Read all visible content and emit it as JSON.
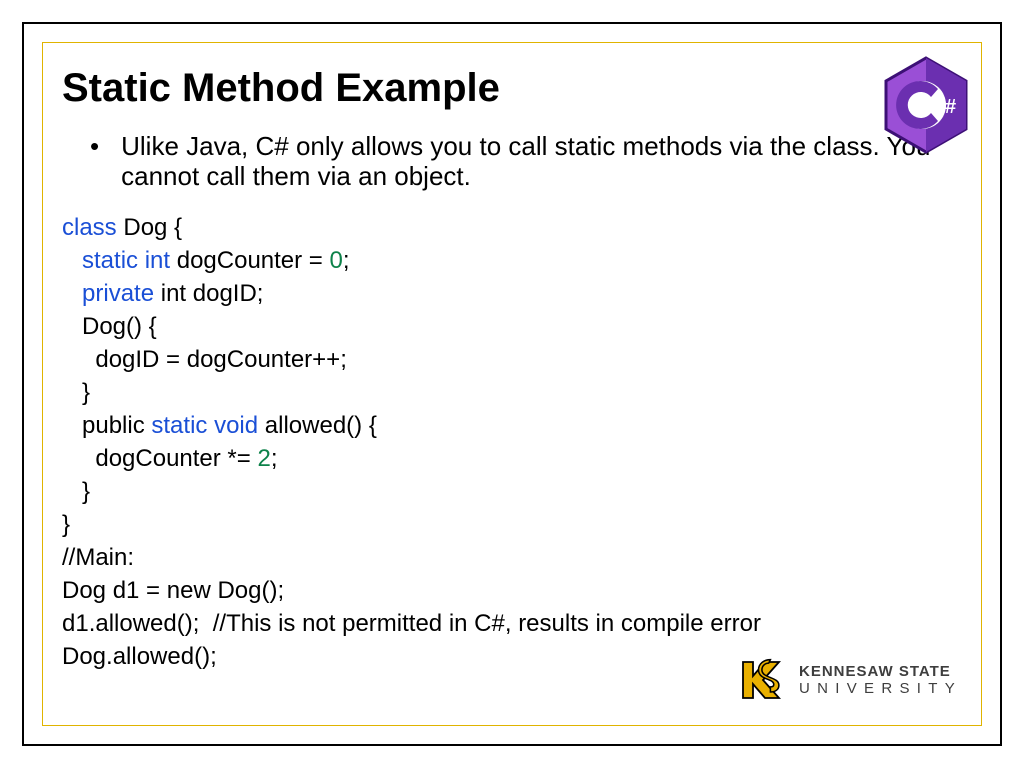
{
  "title": "Static Method Example",
  "bullet": "Ulike Java, C# only allows you to call static methods via the class. You cannot call them via an object.",
  "code": {
    "l1_kw": "class",
    "l1_rest": " Dog {",
    "l2_ind": "   ",
    "l2_kw": "static int",
    "l2_rest1": " dogCounter = ",
    "l2_num": "0",
    "l2_rest2": ";",
    "l3_ind": "   ",
    "l3_kw": "private",
    "l3_rest": " int dogID;",
    "l4": "   Dog() {",
    "l5": "     dogID = dogCounter++;",
    "l6": "   }",
    "l7_pre": "   public ",
    "l7_kw": "static void",
    "l7_rest": " allowed() {",
    "l8_ind": "     dogCounter *= ",
    "l8_num": "2",
    "l8_rest": ";",
    "l9": "   }",
    "l10": "}",
    "l11": "//Main:",
    "l12": "Dog d1 = new Dog();",
    "l13": "d1.allowed();  //This is not permitted in C#, results in compile error",
    "l14": "Dog.allowed();"
  },
  "csharp_label": "C#",
  "ksu": {
    "line1": "KENNESAW STATE",
    "line2": "UNIVERSITY"
  }
}
